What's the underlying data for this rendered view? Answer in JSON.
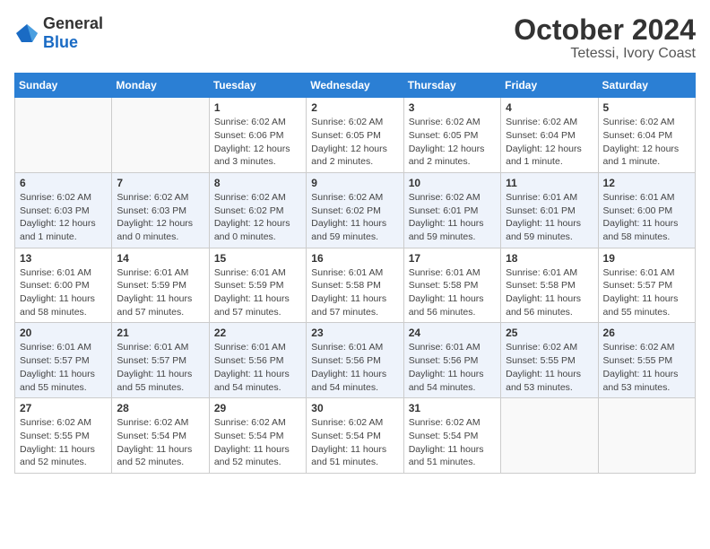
{
  "logo": {
    "line1": "General",
    "line2": "Blue"
  },
  "title": "October 2024",
  "location": "Tetessi, Ivory Coast",
  "weekdays": [
    "Sunday",
    "Monday",
    "Tuesday",
    "Wednesday",
    "Thursday",
    "Friday",
    "Saturday"
  ],
  "rows": [
    [
      {
        "day": "",
        "info": ""
      },
      {
        "day": "",
        "info": ""
      },
      {
        "day": "1",
        "info": "Sunrise: 6:02 AM\nSunset: 6:06 PM\nDaylight: 12 hours\nand 3 minutes."
      },
      {
        "day": "2",
        "info": "Sunrise: 6:02 AM\nSunset: 6:05 PM\nDaylight: 12 hours\nand 2 minutes."
      },
      {
        "day": "3",
        "info": "Sunrise: 6:02 AM\nSunset: 6:05 PM\nDaylight: 12 hours\nand 2 minutes."
      },
      {
        "day": "4",
        "info": "Sunrise: 6:02 AM\nSunset: 6:04 PM\nDaylight: 12 hours\nand 1 minute."
      },
      {
        "day": "5",
        "info": "Sunrise: 6:02 AM\nSunset: 6:04 PM\nDaylight: 12 hours\nand 1 minute."
      }
    ],
    [
      {
        "day": "6",
        "info": "Sunrise: 6:02 AM\nSunset: 6:03 PM\nDaylight: 12 hours\nand 1 minute."
      },
      {
        "day": "7",
        "info": "Sunrise: 6:02 AM\nSunset: 6:03 PM\nDaylight: 12 hours\nand 0 minutes."
      },
      {
        "day": "8",
        "info": "Sunrise: 6:02 AM\nSunset: 6:02 PM\nDaylight: 12 hours\nand 0 minutes."
      },
      {
        "day": "9",
        "info": "Sunrise: 6:02 AM\nSunset: 6:02 PM\nDaylight: 11 hours\nand 59 minutes."
      },
      {
        "day": "10",
        "info": "Sunrise: 6:02 AM\nSunset: 6:01 PM\nDaylight: 11 hours\nand 59 minutes."
      },
      {
        "day": "11",
        "info": "Sunrise: 6:01 AM\nSunset: 6:01 PM\nDaylight: 11 hours\nand 59 minutes."
      },
      {
        "day": "12",
        "info": "Sunrise: 6:01 AM\nSunset: 6:00 PM\nDaylight: 11 hours\nand 58 minutes."
      }
    ],
    [
      {
        "day": "13",
        "info": "Sunrise: 6:01 AM\nSunset: 6:00 PM\nDaylight: 11 hours\nand 58 minutes."
      },
      {
        "day": "14",
        "info": "Sunrise: 6:01 AM\nSunset: 5:59 PM\nDaylight: 11 hours\nand 57 minutes."
      },
      {
        "day": "15",
        "info": "Sunrise: 6:01 AM\nSunset: 5:59 PM\nDaylight: 11 hours\nand 57 minutes."
      },
      {
        "day": "16",
        "info": "Sunrise: 6:01 AM\nSunset: 5:58 PM\nDaylight: 11 hours\nand 57 minutes."
      },
      {
        "day": "17",
        "info": "Sunrise: 6:01 AM\nSunset: 5:58 PM\nDaylight: 11 hours\nand 56 minutes."
      },
      {
        "day": "18",
        "info": "Sunrise: 6:01 AM\nSunset: 5:58 PM\nDaylight: 11 hours\nand 56 minutes."
      },
      {
        "day": "19",
        "info": "Sunrise: 6:01 AM\nSunset: 5:57 PM\nDaylight: 11 hours\nand 55 minutes."
      }
    ],
    [
      {
        "day": "20",
        "info": "Sunrise: 6:01 AM\nSunset: 5:57 PM\nDaylight: 11 hours\nand 55 minutes."
      },
      {
        "day": "21",
        "info": "Sunrise: 6:01 AM\nSunset: 5:57 PM\nDaylight: 11 hours\nand 55 minutes."
      },
      {
        "day": "22",
        "info": "Sunrise: 6:01 AM\nSunset: 5:56 PM\nDaylight: 11 hours\nand 54 minutes."
      },
      {
        "day": "23",
        "info": "Sunrise: 6:01 AM\nSunset: 5:56 PM\nDaylight: 11 hours\nand 54 minutes."
      },
      {
        "day": "24",
        "info": "Sunrise: 6:01 AM\nSunset: 5:56 PM\nDaylight: 11 hours\nand 54 minutes."
      },
      {
        "day": "25",
        "info": "Sunrise: 6:02 AM\nSunset: 5:55 PM\nDaylight: 11 hours\nand 53 minutes."
      },
      {
        "day": "26",
        "info": "Sunrise: 6:02 AM\nSunset: 5:55 PM\nDaylight: 11 hours\nand 53 minutes."
      }
    ],
    [
      {
        "day": "27",
        "info": "Sunrise: 6:02 AM\nSunset: 5:55 PM\nDaylight: 11 hours\nand 52 minutes."
      },
      {
        "day": "28",
        "info": "Sunrise: 6:02 AM\nSunset: 5:54 PM\nDaylight: 11 hours\nand 52 minutes."
      },
      {
        "day": "29",
        "info": "Sunrise: 6:02 AM\nSunset: 5:54 PM\nDaylight: 11 hours\nand 52 minutes."
      },
      {
        "day": "30",
        "info": "Sunrise: 6:02 AM\nSunset: 5:54 PM\nDaylight: 11 hours\nand 51 minutes."
      },
      {
        "day": "31",
        "info": "Sunrise: 6:02 AM\nSunset: 5:54 PM\nDaylight: 11 hours\nand 51 minutes."
      },
      {
        "day": "",
        "info": ""
      },
      {
        "day": "",
        "info": ""
      }
    ]
  ]
}
